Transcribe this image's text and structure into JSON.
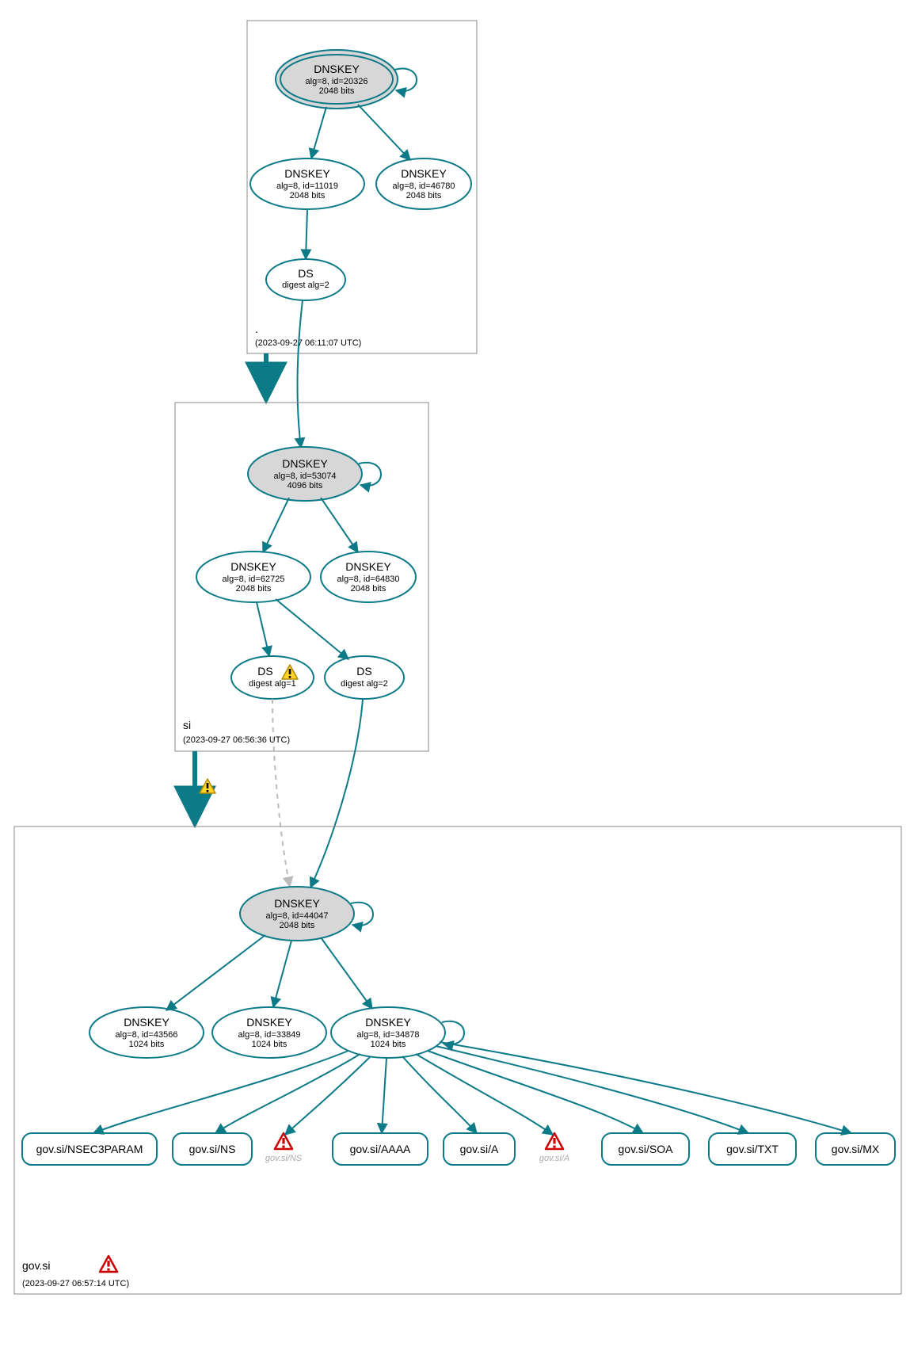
{
  "zones": {
    "root": {
      "name": ".",
      "timestamp": "(2023-09-27 06:11:07 UTC)"
    },
    "si": {
      "name": "si",
      "timestamp": "(2023-09-27 06:56:36 UTC)"
    },
    "gov": {
      "name": "gov.si",
      "timestamp": "(2023-09-27 06:57:14 UTC)"
    }
  },
  "nodes": {
    "root_ksk": {
      "title": "DNSKEY",
      "l1": "alg=8, id=20326",
      "l2": "2048 bits"
    },
    "root_zsk1": {
      "title": "DNSKEY",
      "l1": "alg=8, id=11019",
      "l2": "2048 bits"
    },
    "root_zsk2": {
      "title": "DNSKEY",
      "l1": "alg=8, id=46780",
      "l2": "2048 bits"
    },
    "root_ds": {
      "title": "DS",
      "l1": "digest alg=2",
      "l2": ""
    },
    "si_ksk": {
      "title": "DNSKEY",
      "l1": "alg=8, id=53074",
      "l2": "4096 bits"
    },
    "si_zsk1": {
      "title": "DNSKEY",
      "l1": "alg=8, id=62725",
      "l2": "2048 bits"
    },
    "si_zsk2": {
      "title": "DNSKEY",
      "l1": "alg=8, id=64830",
      "l2": "2048 bits"
    },
    "si_ds1": {
      "title": "DS",
      "l1": "digest alg=1",
      "l2": ""
    },
    "si_ds2": {
      "title": "DS",
      "l1": "digest alg=2",
      "l2": ""
    },
    "gov_ksk": {
      "title": "DNSKEY",
      "l1": "alg=8, id=44047",
      "l2": "2048 bits"
    },
    "gov_zsk1": {
      "title": "DNSKEY",
      "l1": "alg=8, id=43566",
      "l2": "1024 bits"
    },
    "gov_zsk2": {
      "title": "DNSKEY",
      "l1": "alg=8, id=33849",
      "l2": "1024 bits"
    },
    "gov_zsk3": {
      "title": "DNSKEY",
      "l1": "alg=8, id=34878",
      "l2": "1024 bits"
    }
  },
  "rr": {
    "nsec3": "gov.si/NSEC3PARAM",
    "ns": "gov.si/NS",
    "aaaa": "gov.si/AAAA",
    "a": "gov.si/A",
    "soa": "gov.si/SOA",
    "txt": "gov.si/TXT",
    "mx": "gov.si/MX"
  },
  "warnings": {
    "ns_neg": "gov.si/NS",
    "a_neg": "gov.si/A"
  },
  "chart_data": {
    "type": "diagram",
    "description": "DNSSEC delegation/auth graph (DNSViz-style) for gov.si",
    "zones": [
      {
        "name": ".",
        "timestamp": "2023-09-27 06:11:07 UTC"
      },
      {
        "name": "si",
        "timestamp": "2023-09-27 06:56:36 UTC"
      },
      {
        "name": "gov.si",
        "timestamp": "2023-09-27 06:57:14 UTC",
        "status": "error"
      }
    ],
    "keys": [
      {
        "zone": ".",
        "role": "KSK",
        "alg": 8,
        "id": 20326,
        "bits": 2048,
        "trust_anchor": true
      },
      {
        "zone": ".",
        "role": "ZSK",
        "alg": 8,
        "id": 11019,
        "bits": 2048
      },
      {
        "zone": ".",
        "role": "ZSK",
        "alg": 8,
        "id": 46780,
        "bits": 2048
      },
      {
        "zone": "si",
        "role": "KSK",
        "alg": 8,
        "id": 53074,
        "bits": 4096
      },
      {
        "zone": "si",
        "role": "ZSK",
        "alg": 8,
        "id": 62725,
        "bits": 2048
      },
      {
        "zone": "si",
        "role": "ZSK",
        "alg": 8,
        "id": 64830,
        "bits": 2048
      },
      {
        "zone": "gov.si",
        "role": "KSK",
        "alg": 8,
        "id": 44047,
        "bits": 2048
      },
      {
        "zone": "gov.si",
        "role": "ZSK",
        "alg": 8,
        "id": 43566,
        "bits": 1024
      },
      {
        "zone": "gov.si",
        "role": "ZSK",
        "alg": 8,
        "id": 33849,
        "bits": 1024
      },
      {
        "zone": "gov.si",
        "role": "ZSK",
        "alg": 8,
        "id": 34878,
        "bits": 1024
      }
    ],
    "ds": [
      {
        "parent": ".",
        "child": "si",
        "digest_alg": 2
      },
      {
        "parent": "si",
        "child": "gov.si",
        "digest_alg": 1,
        "status": "warning"
      },
      {
        "parent": "si",
        "child": "gov.si",
        "digest_alg": 2
      }
    ],
    "delegations": [
      {
        "from": ".",
        "to": "si",
        "status": "secure"
      },
      {
        "from": "si",
        "to": "gov.si",
        "status": "warning"
      }
    ],
    "rrsets_signed_by": {
      "signer": {
        "zone": "gov.si",
        "id": 34878
      },
      "rrsets": [
        "gov.si/NSEC3PARAM",
        "gov.si/NS",
        "gov.si/AAAA",
        "gov.si/A",
        "gov.si/SOA",
        "gov.si/TXT",
        "gov.si/MX"
      ]
    },
    "negative_responses": [
      "gov.si/NS",
      "gov.si/A"
    ]
  }
}
